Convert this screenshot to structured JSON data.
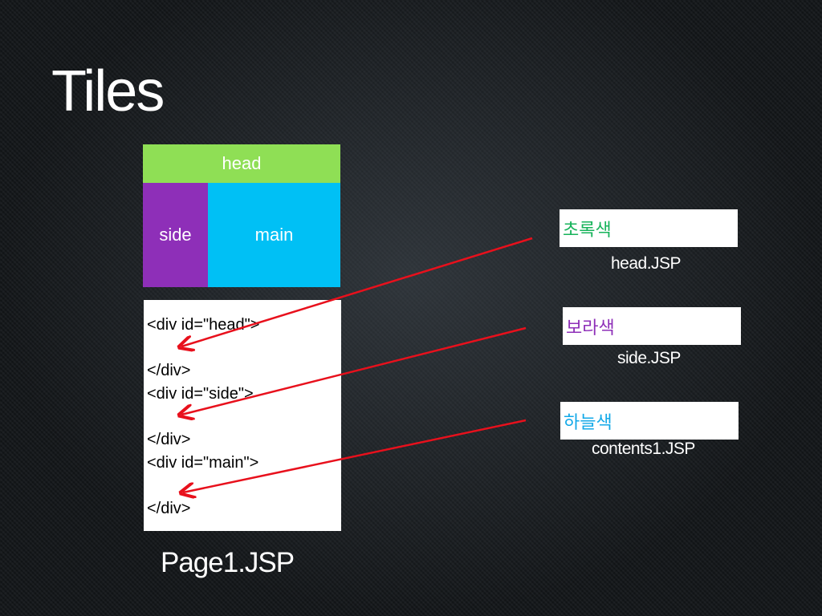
{
  "slide": {
    "title": "Tiles"
  },
  "layout": {
    "head_label": "head",
    "side_label": "side",
    "main_label": "main",
    "colors": {
      "head": "#8fdf55",
      "side": "#8e2fb8",
      "main": "#00c0f5"
    }
  },
  "code": {
    "lines": [
      "<div id=\"head\">",
      "</div>",
      "<div id=\"side\">",
      "</div>",
      "<div id=\"main\">",
      "</div>"
    ]
  },
  "page_caption": "Page1.JSP",
  "tiles": [
    {
      "label": "초록색",
      "caption": "head.JSP",
      "color": "#16b35a"
    },
    {
      "label": "보라색",
      "caption": "side.JSP",
      "color": "#8e2fb8"
    },
    {
      "label": "하늘색",
      "caption": "contents1.JSP",
      "color": "#12a9e8"
    }
  ],
  "arrow_color": "#e8101c"
}
